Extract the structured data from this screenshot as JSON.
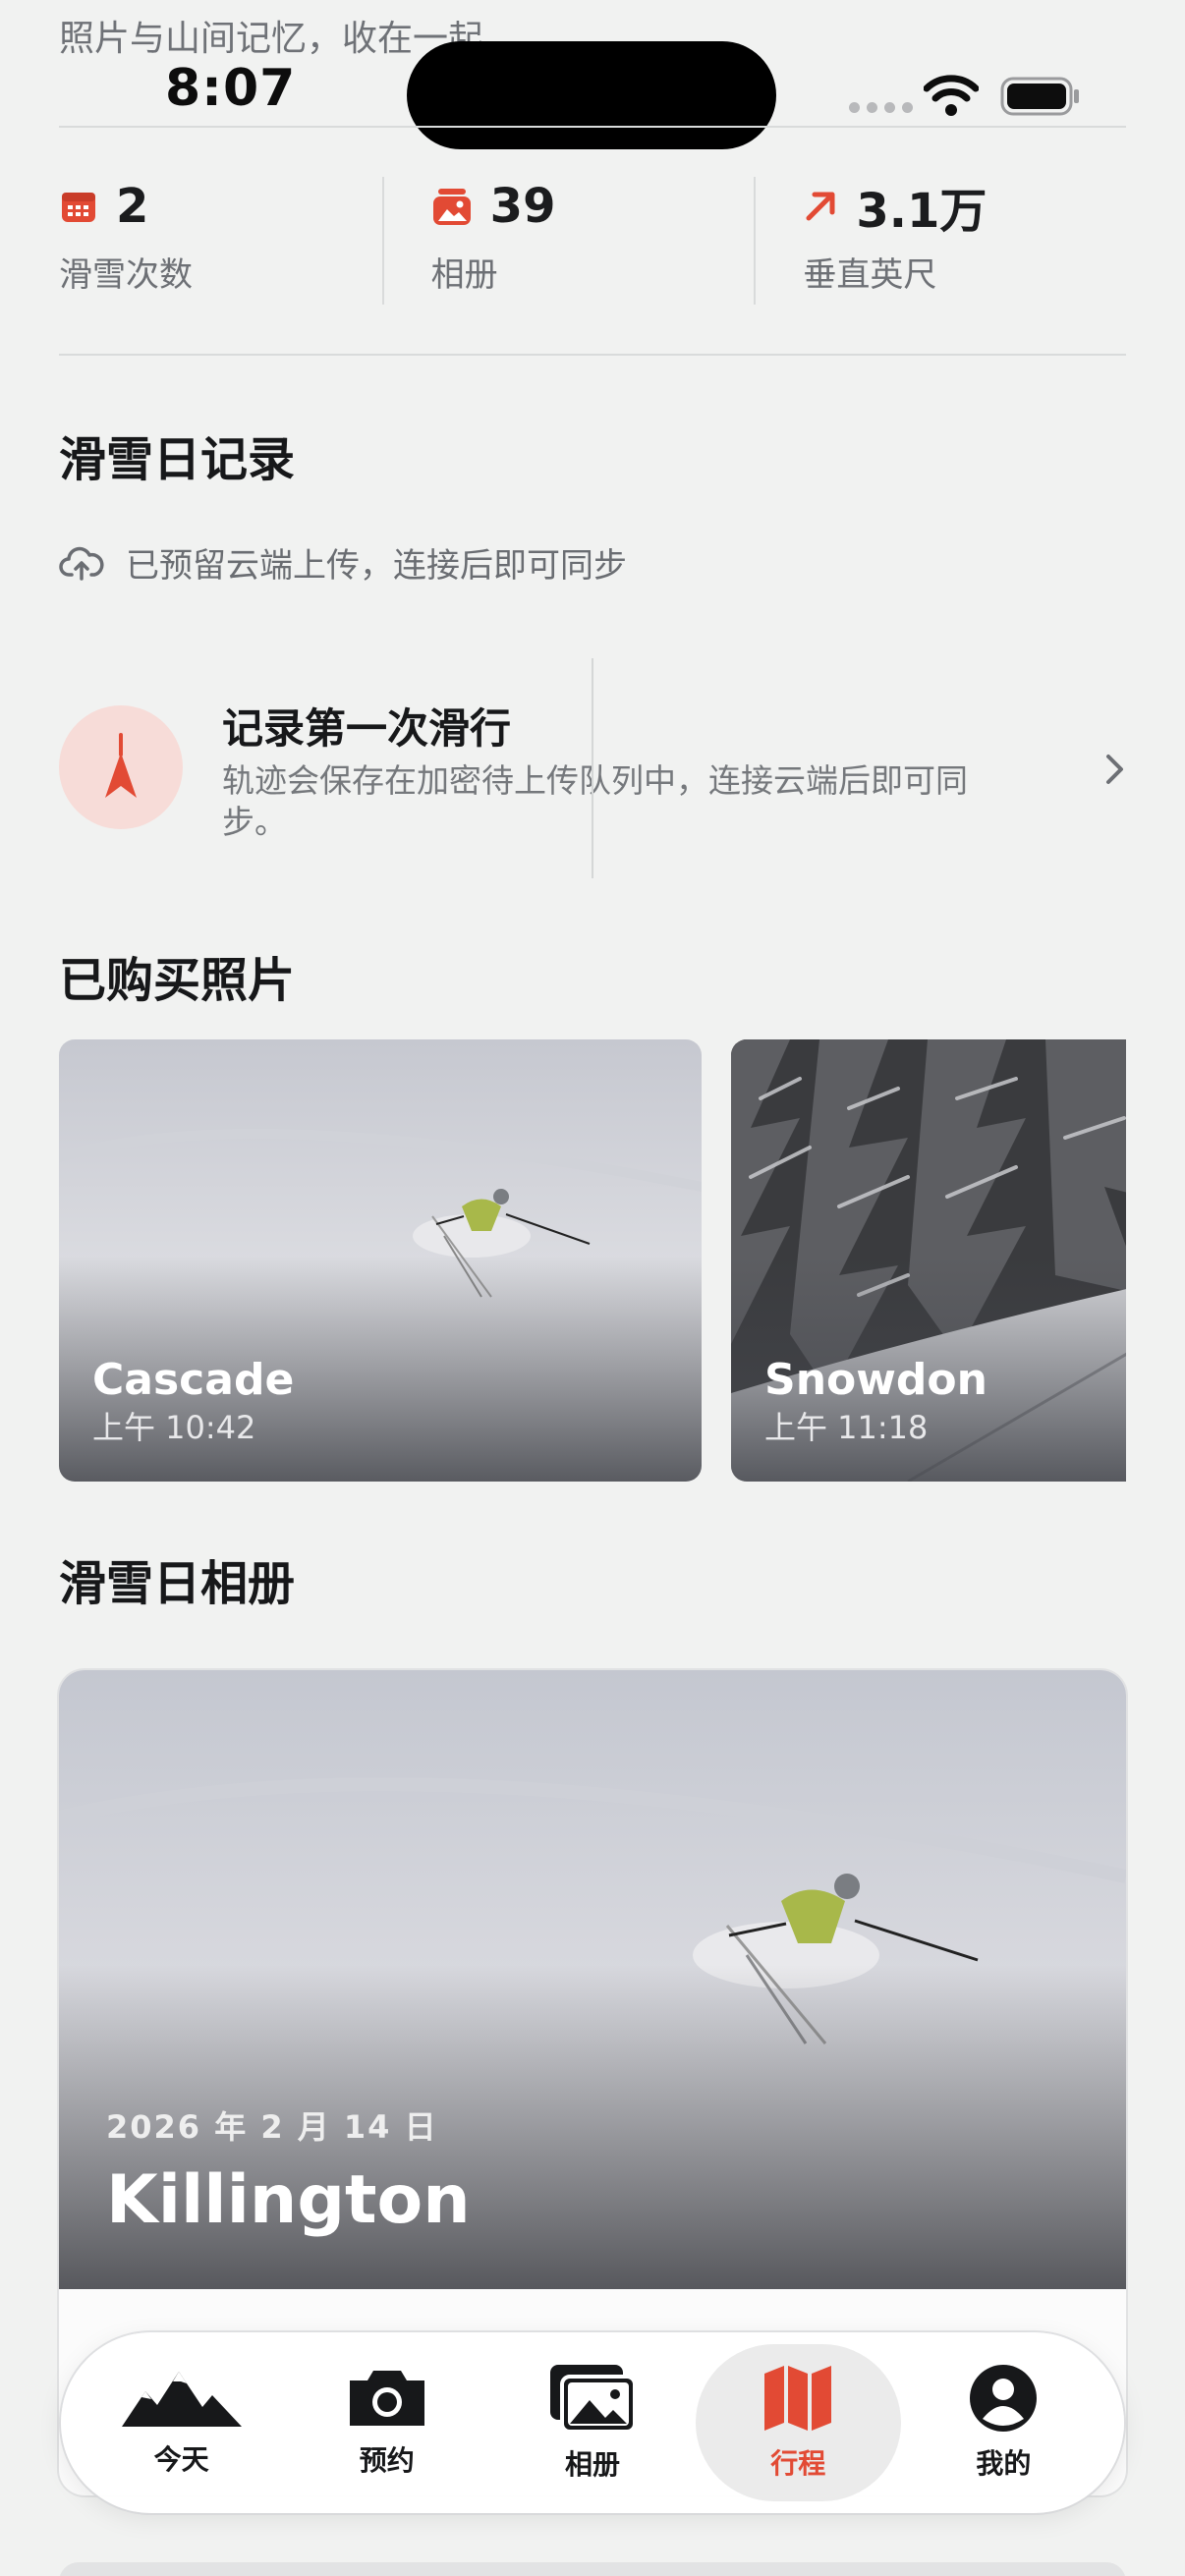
{
  "header": {
    "subtitle": "照片与山间记忆，收在一起",
    "status_time": "8:07"
  },
  "stats": [
    {
      "icon": "calendar-icon",
      "value": "2",
      "label": "滑雪次数"
    },
    {
      "icon": "photo-album-icon",
      "value": "39",
      "label": "相册"
    },
    {
      "icon": "arrow-up-right-icon",
      "value": "3.1万",
      "label": "垂直英尺"
    }
  ],
  "ski_log": {
    "title": "滑雪日记录",
    "sync_text": "已预留云端上传，连接后即可同步",
    "record_card": {
      "title": "记录第一次滑行",
      "description": "轨迹会保存在加密待上传队列中，连接云端后即可同步。"
    }
  },
  "purchased": {
    "title": "已购买照片",
    "photos": [
      {
        "name": "Cascade",
        "time": "上午 10:42"
      },
      {
        "name": "Snowdon",
        "time": "上午 11:18"
      }
    ]
  },
  "albums": {
    "title": "滑雪日相册",
    "items": [
      {
        "date": "2026 年 2 月 14 日",
        "name": "Killington"
      }
    ]
  },
  "tabs": [
    {
      "label": "今天",
      "icon": "mountains-icon",
      "active": false
    },
    {
      "label": "预约",
      "icon": "camera-icon",
      "active": false
    },
    {
      "label": "相册",
      "icon": "photos-icon",
      "active": false
    },
    {
      "label": "行程",
      "icon": "map-icon",
      "active": true
    },
    {
      "label": "我的",
      "icon": "person-circle-icon",
      "active": false
    }
  ],
  "colors": {
    "accent": "#e24a34",
    "background": "#f1f2f1",
    "text": "#17181a",
    "muted": "#6d7075"
  }
}
